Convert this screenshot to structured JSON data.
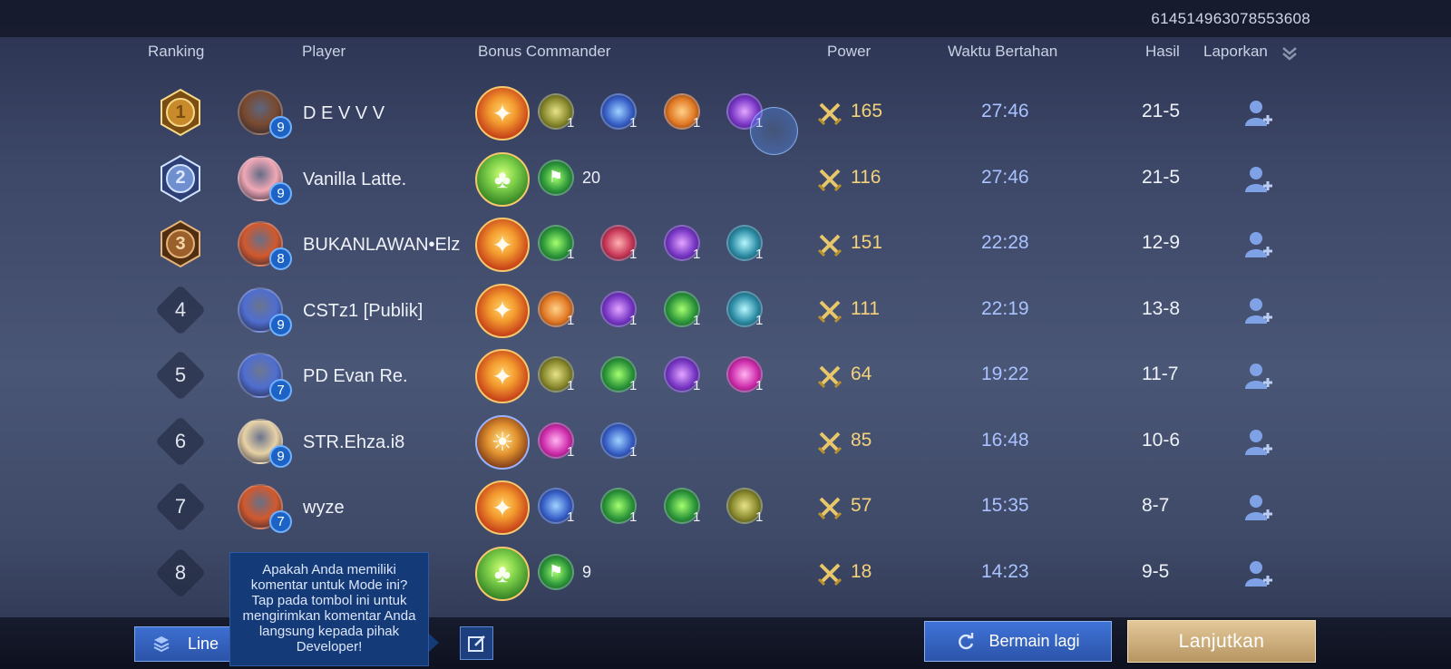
{
  "match_id": "614514963078553608",
  "headers": {
    "ranking": "Ranking",
    "player": "Player",
    "bonus_commander": "Bonus Commander",
    "power": "Power",
    "time": "Waktu Bertahan",
    "hasil": "Hasil",
    "laporkan": "Laporkan"
  },
  "rows": [
    {
      "rank": "1",
      "medal": "gold",
      "name": "D E V V V",
      "level": "9",
      "commander": "orange",
      "subs": [
        {
          "c": "olive",
          "n": "1"
        },
        {
          "c": "blue",
          "n": "1"
        },
        {
          "c": "orange",
          "n": "1"
        },
        {
          "c": "purple",
          "n": "1"
        }
      ],
      "power": "165",
      "time": "27:46",
      "hasil": "21-5",
      "avatar_color": "#7a4a2f"
    },
    {
      "rank": "2",
      "medal": "silver",
      "name": "Vanilla Latte.",
      "level": "9",
      "commander": "green",
      "subs": [
        {
          "c": "green",
          "n": "20",
          "flag": true
        }
      ],
      "power": "116",
      "time": "27:46",
      "hasil": "21-5",
      "avatar_color": "#f1a8b6"
    },
    {
      "rank": "3",
      "medal": "bronze",
      "name": "BUKANLAWAN•Elz",
      "level": "8",
      "commander": "orange",
      "subs": [
        {
          "c": "green",
          "n": "1"
        },
        {
          "c": "red",
          "n": "1"
        },
        {
          "c": "purple",
          "n": "1"
        },
        {
          "c": "teal",
          "n": "1"
        }
      ],
      "power": "151",
      "time": "22:28",
      "hasil": "12-9",
      "avatar_color": "#d2592e"
    },
    {
      "rank": "4",
      "medal": "",
      "name": "CSTz1 [Publik]",
      "level": "9",
      "commander": "orange",
      "subs": [
        {
          "c": "orange",
          "n": "1"
        },
        {
          "c": "purple",
          "n": "1"
        },
        {
          "c": "green",
          "n": "1"
        },
        {
          "c": "teal",
          "n": "1"
        }
      ],
      "power": "111",
      "time": "22:19",
      "hasil": "13-8",
      "avatar_color": "#4f6ed0"
    },
    {
      "rank": "5",
      "medal": "",
      "name": "PD Evan Re.",
      "level": "7",
      "commander": "orange",
      "subs": [
        {
          "c": "olive",
          "n": "1"
        },
        {
          "c": "green",
          "n": "1"
        },
        {
          "c": "purple",
          "n": "1"
        },
        {
          "c": "pink",
          "n": "1"
        }
      ],
      "power": "64",
      "time": "19:22",
      "hasil": "11-7",
      "avatar_color": "#4f6ed0"
    },
    {
      "rank": "6",
      "medal": "",
      "name": "STR.Ehza.i8",
      "level": "9",
      "commander": "gold",
      "subs": [
        {
          "c": "pink",
          "n": "1"
        },
        {
          "c": "blue",
          "n": "1"
        }
      ],
      "power": "85",
      "time": "16:48",
      "hasil": "10-6",
      "avatar_color": "#e8d2a6"
    },
    {
      "rank": "7",
      "medal": "",
      "name": "wyze",
      "level": "7",
      "commander": "orange",
      "subs": [
        {
          "c": "blue",
          "n": "1"
        },
        {
          "c": "green",
          "n": "1"
        },
        {
          "c": "green",
          "n": "1"
        },
        {
          "c": "olive",
          "n": "1"
        }
      ],
      "power": "57",
      "time": "15:35",
      "hasil": "8-7",
      "avatar_color": "#d2592e"
    },
    {
      "rank": "8",
      "medal": "",
      "name": "",
      "level": "",
      "commander": "green",
      "subs": [
        {
          "c": "green",
          "n": "9",
          "flag": true
        }
      ],
      "power": "18",
      "time": "14:23",
      "hasil": "9-5",
      "avatar_color": ""
    }
  ],
  "tooltip": "Apakah Anda memiliki komentar untuk Mode ini? Tap pada tombol ini untuk mengirimkan komentar Anda langsung kepada pihak Developer!",
  "buttons": {
    "lineup": "Line",
    "play_again": "Bermain lagi",
    "continue": "Lanjutkan"
  },
  "colors": {
    "power": "#f3d27a",
    "time": "#a9c2ff",
    "gold_button": "#d2b47f",
    "blue_button": "#3565c0"
  }
}
